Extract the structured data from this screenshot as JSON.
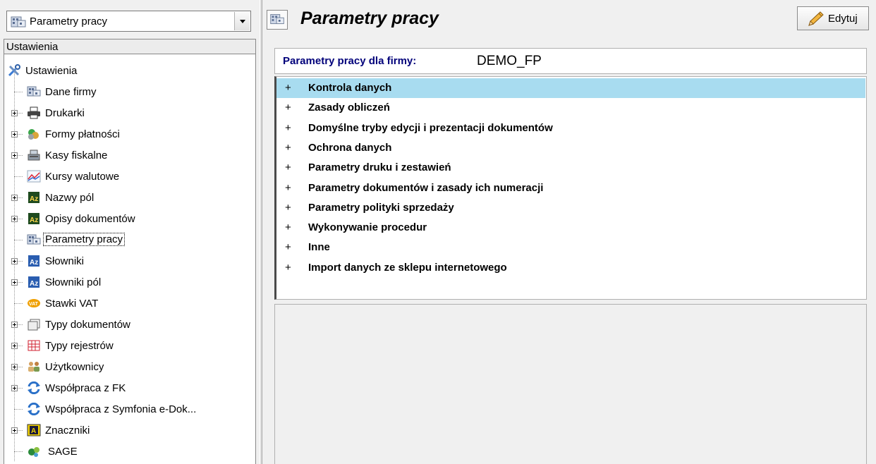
{
  "left": {
    "combo_value": "Parametry pracy",
    "section_header": "Ustawienia",
    "tree": [
      {
        "label": "Ustawienia",
        "icon": "tools-icon",
        "level": 0,
        "expand": false
      },
      {
        "label": "Dane firmy",
        "icon": "building-icon",
        "level": 1,
        "expand": false
      },
      {
        "label": "Drukarki",
        "icon": "printer-icon",
        "level": 1,
        "expand": true
      },
      {
        "label": "Formy płatności",
        "icon": "coins-icon",
        "level": 1,
        "expand": true
      },
      {
        "label": "Kasy fiskalne",
        "icon": "cash-register-icon",
        "level": 1,
        "expand": true
      },
      {
        "label": "Kursy walutowe",
        "icon": "chart-line-icon",
        "level": 1,
        "expand": false
      },
      {
        "label": "Nazwy pól",
        "icon": "az-dark-icon",
        "level": 1,
        "expand": true
      },
      {
        "label": "Opisy dokumentów",
        "icon": "az-dark-icon",
        "level": 1,
        "expand": true
      },
      {
        "label": "Parametry pracy",
        "icon": "building-icon",
        "level": 1,
        "expand": false,
        "selected": true
      },
      {
        "label": "Słowniki",
        "icon": "az-blue-icon",
        "level": 1,
        "expand": true
      },
      {
        "label": "Słowniki pól",
        "icon": "az-blue-icon",
        "level": 1,
        "expand": true
      },
      {
        "label": "Stawki VAT",
        "icon": "vat-icon",
        "level": 1,
        "expand": false
      },
      {
        "label": "Typy dokumentów",
        "icon": "documents-icon",
        "level": 1,
        "expand": true
      },
      {
        "label": "Typy rejestrów",
        "icon": "grid-icon",
        "level": 1,
        "expand": true
      },
      {
        "label": "Użytkownicy",
        "icon": "users-icon",
        "level": 1,
        "expand": true
      },
      {
        "label": "Współpraca z FK",
        "icon": "sync-icon",
        "level": 1,
        "expand": true
      },
      {
        "label": "Współpraca z Symfonia e-Dok...",
        "icon": "sync-icon",
        "level": 1,
        "expand": false
      },
      {
        "label": "Znaczniki",
        "icon": "marker-icon",
        "level": 1,
        "expand": true
      },
      {
        "label": "SAGE",
        "icon": "sage-icon",
        "level": 1,
        "expand": false
      }
    ]
  },
  "right": {
    "title": "Parametry pracy",
    "edit_label": "Edytuj",
    "firm_label": "Parametry pracy dla firmy:",
    "firm_value": "DEMO_FP",
    "params": [
      {
        "label": "Kontrola danych",
        "highlighted": true
      },
      {
        "label": "Zasady obliczeń"
      },
      {
        "label": "Domyślne tryby edycji i prezentacji dokumentów"
      },
      {
        "label": "Ochrona danych"
      },
      {
        "label": "Parametry druku i zestawień"
      },
      {
        "label": "Parametry dokumentów i zasady ich numeracji"
      },
      {
        "label": "Parametry polityki sprzedaży"
      },
      {
        "label": "Wykonywanie procedur"
      },
      {
        "label": "Inne"
      },
      {
        "label": "Import danych ze sklepu internetowego"
      }
    ],
    "plus_symbol": "+"
  },
  "colors": {
    "highlight": "#a8dcf0",
    "firm_label": "#00007a"
  }
}
